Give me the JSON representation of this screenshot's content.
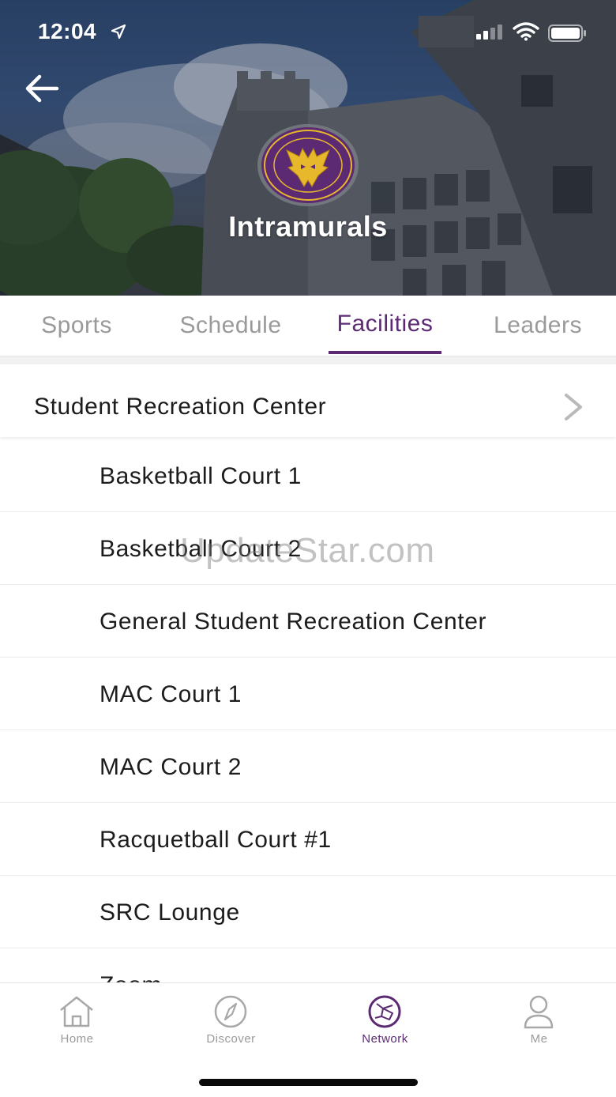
{
  "status_bar": {
    "time": "12:04",
    "icons": [
      "location-arrow-icon",
      "cellular-signal-icon",
      "wifi-icon",
      "battery-icon"
    ]
  },
  "header": {
    "title": "Intramurals",
    "back_icon": "back-arrow-icon",
    "logo_icon": "club-logo",
    "accent_color": "#5c2a73",
    "logo_gold": "#e7b72c"
  },
  "tabs": [
    {
      "label": "Sports",
      "active": false
    },
    {
      "label": "Schedule",
      "active": false
    },
    {
      "label": "Facilities",
      "active": true
    },
    {
      "label": "Leaders",
      "active": false
    }
  ],
  "facilities": {
    "group": {
      "label": "Student Recreation Center",
      "icon": "chevron-right-icon"
    },
    "items": [
      "Basketball Court 1",
      "Basketball Court 2",
      "General Student Recreation Center",
      "MAC Court 1",
      "MAC Court 2",
      "Racquetball Court #1",
      "SRC Lounge",
      "Zoom"
    ]
  },
  "watermark": "UpdateStar.com",
  "bottom_nav": [
    {
      "label": "Home",
      "icon": "home-icon",
      "active": false
    },
    {
      "label": "Discover",
      "icon": "compass-icon",
      "active": false
    },
    {
      "label": "Network",
      "icon": "network-icon",
      "active": true
    },
    {
      "label": "Me",
      "icon": "person-icon",
      "active": false
    }
  ]
}
